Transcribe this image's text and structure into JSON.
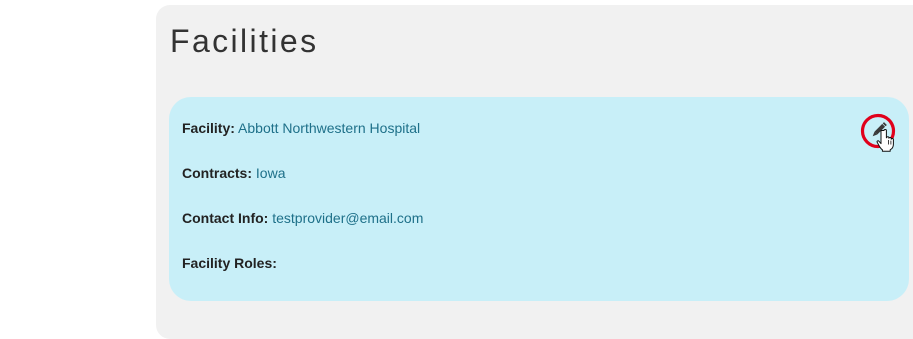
{
  "facilities": {
    "title": "Facilities",
    "card": {
      "facility_label": "Facility:",
      "facility_value": "Abbott Northwestern Hospital",
      "contracts_label": "Contracts:",
      "contracts_value": "Iowa",
      "contact_label": "Contact Info:",
      "contact_value": "testprovider@email.com",
      "roles_label": "Facility Roles:",
      "roles_value": ""
    },
    "edit_icon": "pencil-icon",
    "highlight_color": "#e0001b",
    "card_color": "#c8eff8",
    "panel_color": "#f1f1f1",
    "value_color": "#1e7089"
  }
}
